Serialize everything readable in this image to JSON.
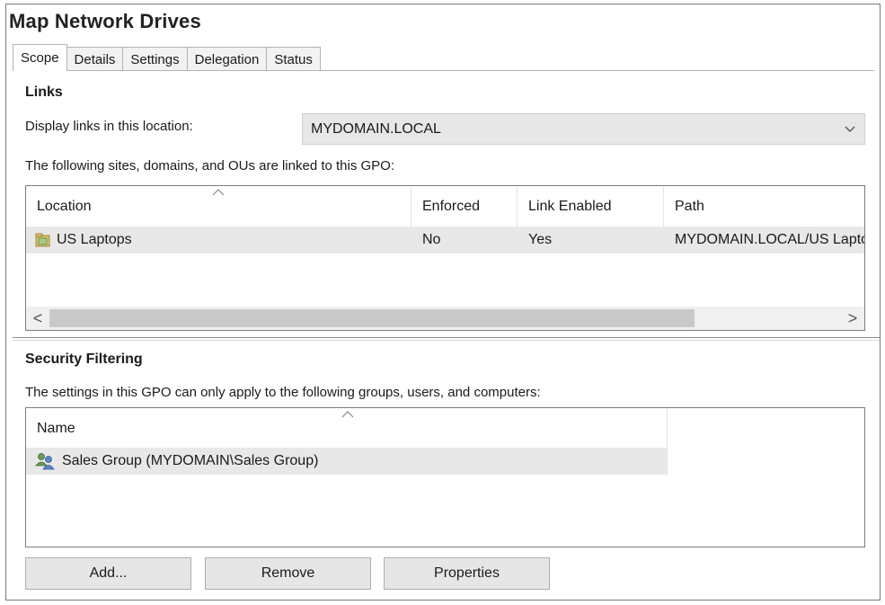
{
  "window": {
    "title": "Map Network Drives"
  },
  "tabs": [
    {
      "label": "Scope"
    },
    {
      "label": "Details"
    },
    {
      "label": "Settings"
    },
    {
      "label": "Delegation"
    },
    {
      "label": "Status"
    }
  ],
  "active_tab": "Scope",
  "links": {
    "heading": "Links",
    "display_label": "Display links in this location:",
    "location_value": "MYDOMAIN.LOCAL",
    "description": "The following sites, domains, and OUs are linked to this GPO:",
    "columns": [
      "Location",
      "Enforced",
      "Link Enabled",
      "Path"
    ],
    "rows": [
      {
        "location": "US Laptops",
        "enforced": "No",
        "link_enabled": "Yes",
        "path": "MYDOMAIN.LOCAL/US Laptops"
      }
    ],
    "scroll_left": "<",
    "scroll_right": ">"
  },
  "security": {
    "heading": "Security Filtering",
    "description": "The settings in this GPO can only apply to the following groups, users, and computers:",
    "columns": [
      "Name"
    ],
    "rows": [
      {
        "name": "Sales Group (MYDOMAIN\\Sales Group)"
      }
    ]
  },
  "buttons": {
    "add": "Add...",
    "remove": "Remove",
    "properties": "Properties"
  },
  "icons": {
    "ou": "organizational-unit-icon",
    "group": "user-group-icon"
  }
}
